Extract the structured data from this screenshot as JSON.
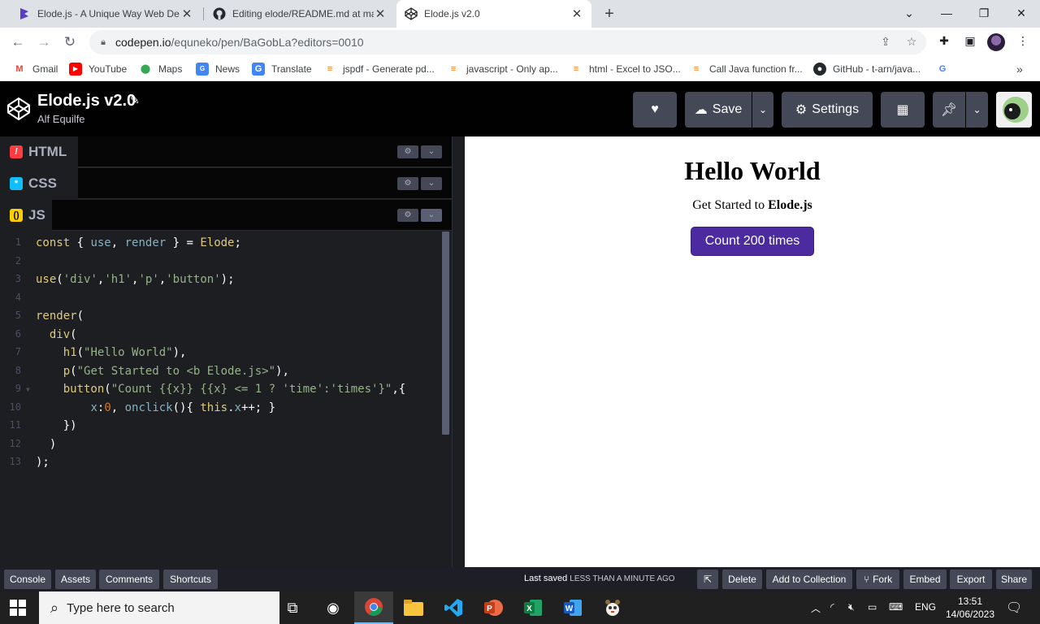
{
  "browser": {
    "tabs": [
      {
        "title": "Elode.js - A Unique Way Web De"
      },
      {
        "title": "Editing elode/README.md at ma"
      },
      {
        "title": "Elode.js v2.0"
      }
    ],
    "url_host": "codepen.io",
    "url_path": "/equneko/pen/BaGobLa?editors=0010",
    "bookmarks": [
      {
        "label": "Gmail"
      },
      {
        "label": "YouTube"
      },
      {
        "label": "Maps"
      },
      {
        "label": "News"
      },
      {
        "label": "Translate"
      },
      {
        "label": "jspdf - Generate pd..."
      },
      {
        "label": "javascript - Only ap..."
      },
      {
        "label": "html - Excel to JSO..."
      },
      {
        "label": "Call Java function fr..."
      },
      {
        "label": "GitHub - t-arn/java..."
      }
    ]
  },
  "codepen": {
    "pen_title": "Elode.js v2.0",
    "author": "Alf Equilfe",
    "save_label": "Save",
    "settings_label": "Settings",
    "editors": {
      "html": "HTML",
      "css": "CSS",
      "js": "JS"
    },
    "code_lines": [
      {
        "n": "1"
      },
      {
        "n": "2"
      },
      {
        "n": "3"
      },
      {
        "n": "4"
      },
      {
        "n": "5"
      },
      {
        "n": "6"
      },
      {
        "n": "7"
      },
      {
        "n": "8"
      },
      {
        "n": "9"
      },
      {
        "n": "10"
      },
      {
        "n": "11"
      },
      {
        "n": "12"
      },
      {
        "n": "13"
      }
    ],
    "preview": {
      "heading": "Hello World",
      "sub_prefix": "Get Started to ",
      "sub_bold": "Elode.js",
      "button": "Count 200 times"
    },
    "footer": {
      "console": "Console",
      "assets": "Assets",
      "comments": "Comments",
      "shortcuts": "Shortcuts",
      "saved_prefix": "Last saved",
      "saved_time": "LESS THAN A MINUTE AGO",
      "delete": "Delete",
      "add_collection": "Add to Collection",
      "fork": "Fork",
      "embed": "Embed",
      "export": "Export",
      "share": "Share"
    }
  },
  "taskbar": {
    "search_placeholder": "Type here to search",
    "language": "ENG",
    "time": "13:51",
    "date": "14/06/2023"
  },
  "colors": {
    "accent_button": "#4c2aa0",
    "codepen_bg": "#010101",
    "editor_bg": "#1d1e22"
  }
}
